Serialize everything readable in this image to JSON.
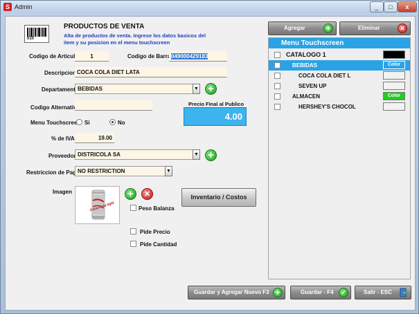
{
  "window": {
    "title": "Admin",
    "app_icon_letter": "S",
    "close_glyph": "x",
    "min_glyph": "_",
    "max_glyph": "□"
  },
  "header": {
    "title": "PRODUCTOS DE VENTA",
    "subtitle_line1": "Alta de productos de venta. Ingrese los datos basicos del",
    "subtitle_line2": "item y su posicion en el menu touchscreen",
    "barcode_digits": "010"
  },
  "form": {
    "codigo_articulo_label": "Codigo de Articulo",
    "codigo_articulo_value": "1",
    "codigo_barras_label": "Codigo de Barras",
    "codigo_barras_value": "049000429183",
    "descripcion_label": "Descripcion",
    "descripcion_value": "COCA COLA DIET LATA",
    "departamento_label": "Departamento",
    "departamento_value": "BEBIDAS",
    "codigo_alternativo_label": "Codigo Alternativo",
    "codigo_alternativo_value": "",
    "precio_final_label": "Precio Final al Publico",
    "precio_final_value": "4.00",
    "menu_touchscreen_label": "Menu Touchscreen",
    "menu_option_si": "Si",
    "menu_option_no": "No",
    "iva_label": "% de IVA",
    "iva_value": "19.00",
    "proveedor_label": "Proveedor",
    "proveedor_value": "DISTRICOLA SA",
    "restriccion_label": "Restriccion de Pago",
    "restriccion_value": "NO RESTRICTION",
    "imagen_label": "Imagen",
    "peso_balanza_label": "Peso Balanza",
    "pide_precio_label": "Pide Precio",
    "pide_cantidad_label": "Pide Cantidad",
    "inventario_button": "Inventario / Costos",
    "can_text": "Coca-Cola light"
  },
  "panel": {
    "agregar_button": "Agregar",
    "eliminar_button": "Eliminar",
    "tree_title": "Menu Touchscreen",
    "items": [
      {
        "label": "CATALOGO 1",
        "checked": false,
        "selected": false,
        "swatch": "",
        "swatch_color": "#000000"
      },
      {
        "label": "BEBIDAS",
        "checked": true,
        "selected": true,
        "swatch": "Color",
        "swatch_color": "#2aa3e6"
      },
      {
        "label": "COCA COLA DIET L",
        "checked": false,
        "selected": false,
        "swatch": "",
        "swatch_color": "#f2f2f2"
      },
      {
        "label": "SEVEN UP",
        "checked": false,
        "selected": false,
        "swatch": "",
        "swatch_color": "#f2f2f2"
      },
      {
        "label": "ALMACEN",
        "checked": false,
        "selected": false,
        "swatch": "Color",
        "swatch_color": "#22cc22"
      },
      {
        "label": "HERSHEY'S CHOCOL",
        "checked": false,
        "selected": false,
        "swatch": "",
        "swatch_color": "#f2f2f2"
      }
    ]
  },
  "footer": {
    "guardar_nuevo_button": "Guardar y Agregar Nuevo F3",
    "guardar_button": "Guardar - F4",
    "salir_button": "Salir - ESC"
  },
  "colors": {
    "accent_blue": "#2aa3e6",
    "green": "#1e9a1e",
    "red": "#c21d1d"
  }
}
